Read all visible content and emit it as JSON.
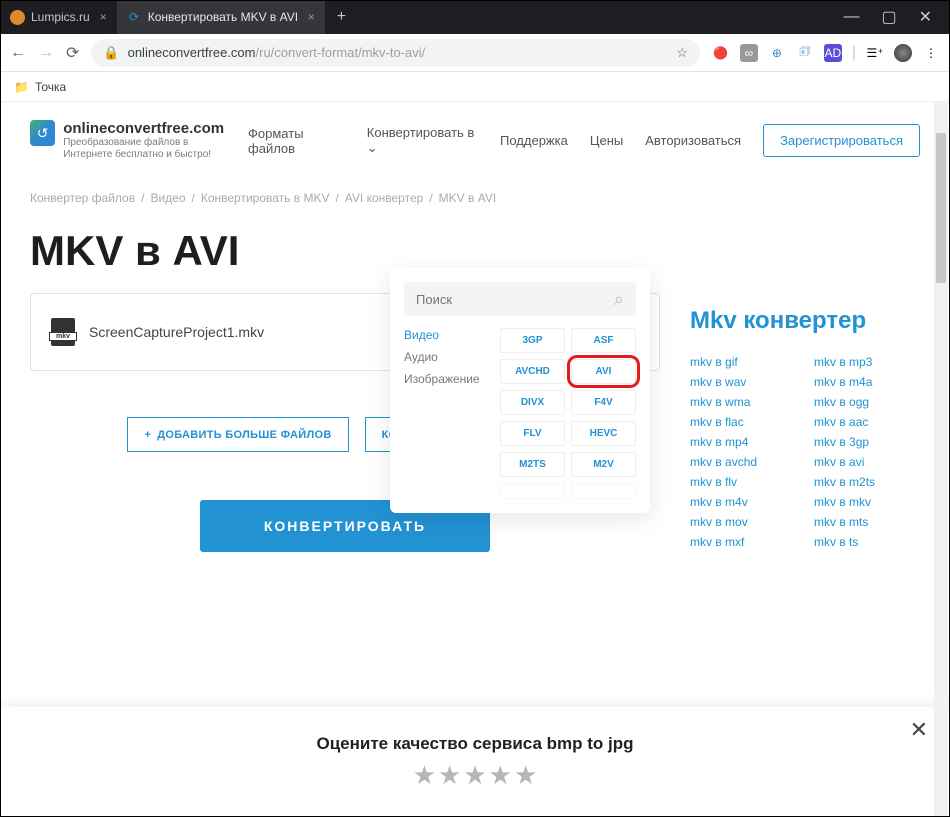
{
  "browser": {
    "tabs": [
      {
        "title": "Lumpics.ru",
        "favicon_color": "#e28a2b"
      },
      {
        "title": "Конвертировать MKV в AVI онл",
        "favicon_color": "#2292d3"
      }
    ],
    "url_secure": true,
    "url_host": "onlineconvertfree.com",
    "url_path": "/ru/convert-format/mkv-to-avi/",
    "bookmark": "Точка"
  },
  "site": {
    "brand": "onlineconvertfree.com",
    "tagline": "Преобразование файлов в Интернете бесплатно и быстро!",
    "nav": {
      "formats": "Форматы файлов",
      "convert": "Конвертировать в",
      "support": "Поддержка",
      "pricing": "Цены",
      "login": "Авторизоваться",
      "signup": "Зарегистрироваться"
    }
  },
  "breadcrumbs": [
    "Конвертер файлов",
    "Видео",
    "Конвертировать в MKV",
    "AVI конвертер",
    "MKV в AVI"
  ],
  "title": "MKV в AVI",
  "file": {
    "name": "ScreenCaptureProject1.mkv"
  },
  "buttons": {
    "add_more": "ДОБАВИТЬ БОЛЬШЕ ФАЙЛОВ",
    "convert_all": "КОНВЕРТИРОВАТЬ ВСЕ В",
    "convert_big": "КОНВЕРТИРОВАТЬ"
  },
  "dropdown": {
    "search_placeholder": "Поиск",
    "categories": [
      "Видео",
      "Аудио",
      "Изображение"
    ],
    "active_category": "Видео",
    "chips": [
      "3GP",
      "ASF",
      "AVCHD",
      "AVI",
      "DIVX",
      "F4V",
      "FLV",
      "HEVC",
      "M2TS",
      "M2V"
    ],
    "highlighted": "AVI"
  },
  "sidebar": {
    "title": "Mkv конвертер",
    "links_col1": [
      "mkv в gif",
      "mkv в wav",
      "mkv в wma",
      "mkv в flac",
      "mkv в mp4",
      "mkv в avchd",
      "mkv в flv",
      "mkv в m4v",
      "mkv в mov",
      "mkv в mxf"
    ],
    "links_col2": [
      "mkv в mp3",
      "mkv в m4a",
      "mkv в ogg",
      "mkv в aac",
      "mkv в 3gp",
      "mkv в avi",
      "mkv в m2ts",
      "mkv в mkv",
      "mkv в mts",
      "mkv в ts"
    ]
  },
  "rating": {
    "title": "Оцените качество сервиса bmp to jpg"
  }
}
